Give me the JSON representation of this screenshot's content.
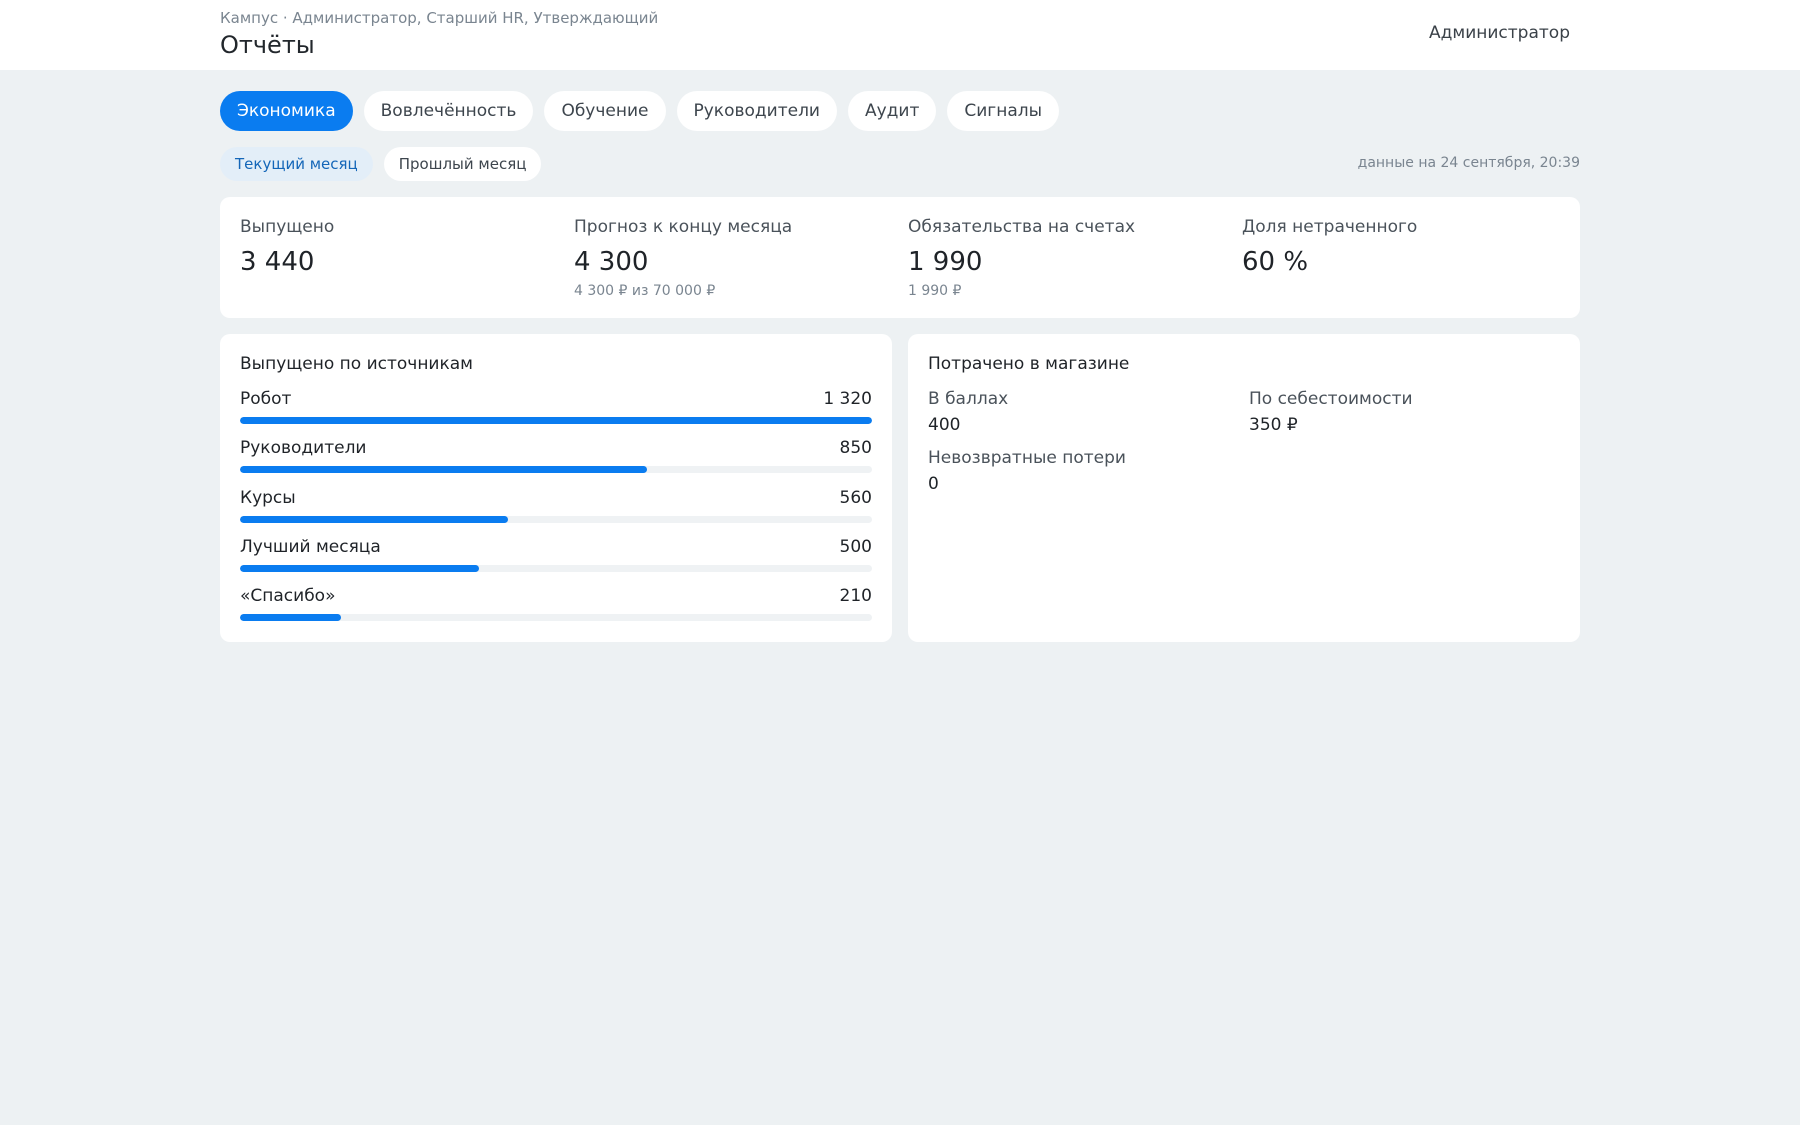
{
  "header": {
    "breadcrumb": "Кампус · Администратор, Старший HR, Утверждающий",
    "title": "Отчёты",
    "user": "Администратор"
  },
  "tabs": [
    {
      "label": "Экономика",
      "active": true
    },
    {
      "label": "Вовлечённость",
      "active": false
    },
    {
      "label": "Обучение",
      "active": false
    },
    {
      "label": "Руководители",
      "active": false
    },
    {
      "label": "Аудит",
      "active": false
    },
    {
      "label": "Сигналы",
      "active": false
    }
  ],
  "periods": [
    {
      "label": "Текущий месяц",
      "active": true
    },
    {
      "label": "Прошлый месяц",
      "active": false
    }
  ],
  "as_of": "данные на 24 сентября, 20:39",
  "kpis": [
    {
      "label": "Выпущено",
      "value": "3 440",
      "sub": ""
    },
    {
      "label": "Прогноз к концу месяца",
      "value": "4 300",
      "sub": "4 300 ₽ из 70 000 ₽"
    },
    {
      "label": "Обязательства на счетах",
      "value": "1 990",
      "sub": "1 990 ₽"
    },
    {
      "label": "Доля нетраченного",
      "value": "60 %",
      "sub": ""
    }
  ],
  "sources": {
    "title": "Выпущено по источникам",
    "items": [
      {
        "label": "Робот",
        "value": "1 320",
        "amount": 1320
      },
      {
        "label": "Руководители",
        "value": "850",
        "amount": 850
      },
      {
        "label": "Курсы",
        "value": "560",
        "amount": 560
      },
      {
        "label": "Лучший месяца",
        "value": "500",
        "amount": 500
      },
      {
        "label": "«Спасибо»",
        "value": "210",
        "amount": 210
      }
    ],
    "max": 1320
  },
  "shop": {
    "title": "Потрачено в магазине",
    "points_label": "В баллах",
    "points_value": "400",
    "cost_label": "По себестоимости",
    "cost_value": "350 ₽",
    "loss_label": "Невозвратные потери",
    "loss_value": "0"
  },
  "colors": {
    "accent": "#0a7cf0",
    "background": "#edf1f3",
    "card": "#ffffff"
  }
}
